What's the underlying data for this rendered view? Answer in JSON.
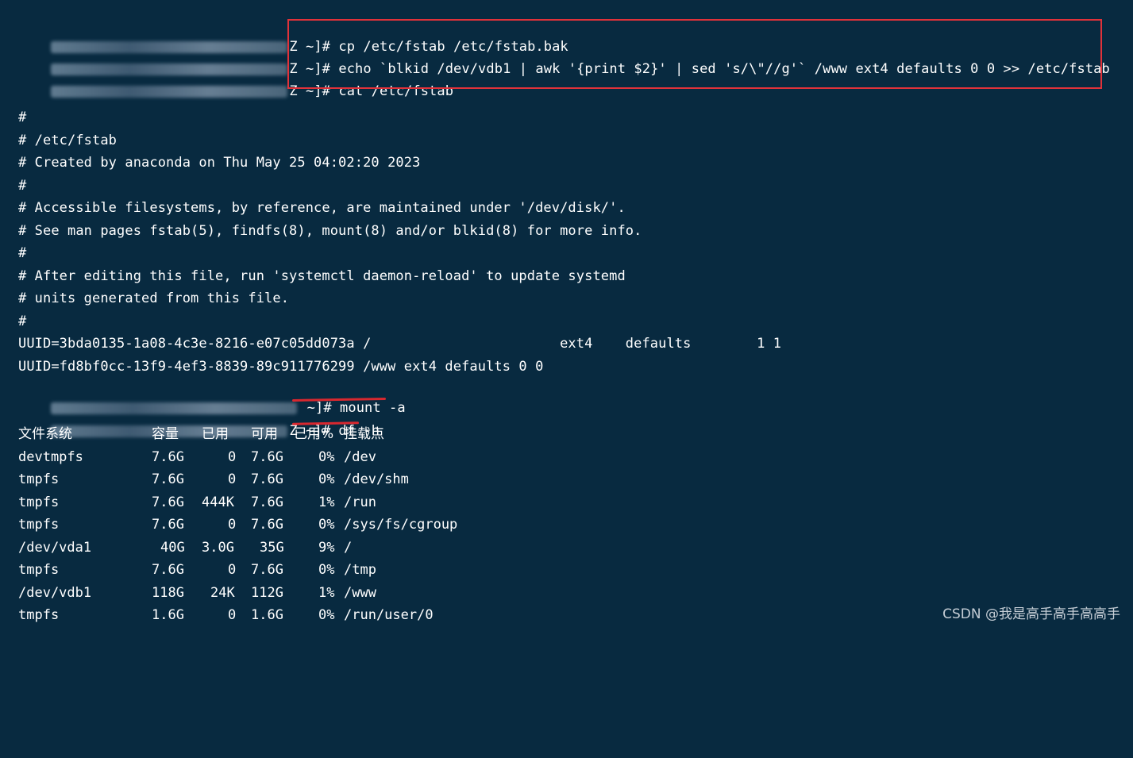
{
  "terminal": {
    "commands": [
      {
        "prompt_suffix": "Z ~]#",
        "command": " cp /etc/fstab /etc/fstab.bak"
      },
      {
        "prompt_suffix": "Z ~]#",
        "command": " echo `blkid /dev/vdb1 | awk '{print $2}' | sed 's/\\\"//g'` /www ext4 defaults 0 0 >> /etc/fstab"
      },
      {
        "prompt_suffix": "Z ~]#",
        "command": " cat /etc/fstab"
      }
    ],
    "fstab_lines": [
      "#",
      "# /etc/fstab",
      "# Created by anaconda on Thu May 25 04:02:20 2023",
      "#",
      "# Accessible filesystems, by reference, are maintained under '/dev/disk/'.",
      "# See man pages fstab(5), findfs(8), mount(8) and/or blkid(8) for more info.",
      "#",
      "# After editing this file, run 'systemctl daemon-reload' to update systemd",
      "# units generated from this file.",
      "#",
      "UUID=3bda0135-1a08-4c3e-8216-e07c05dd073a /                       ext4    defaults        1 1",
      "UUID=fd8bf0cc-13f9-4ef3-8839-89c911776299 /www ext4 defaults 0 0"
    ],
    "mount_cmd": {
      "prompt_suffix": " ~]#",
      "command": " mount -a"
    },
    "df_cmd": {
      "prompt_suffix": "Z ~]#",
      "command": " df -h"
    },
    "df_header": {
      "filesystem": "文件系统",
      "size": "容量",
      "used": "已用",
      "avail": "可用",
      "use_pct": "已用%",
      "mounted_on": "挂载点"
    },
    "df_rows": [
      {
        "fs": "devtmpfs",
        "size": "7.6G",
        "used": "0",
        "avail": "7.6G",
        "pct": "0%",
        "mount": "/dev"
      },
      {
        "fs": "tmpfs",
        "size": "7.6G",
        "used": "0",
        "avail": "7.6G",
        "pct": "0%",
        "mount": "/dev/shm"
      },
      {
        "fs": "tmpfs",
        "size": "7.6G",
        "used": "444K",
        "avail": "7.6G",
        "pct": "1%",
        "mount": "/run"
      },
      {
        "fs": "tmpfs",
        "size": "7.6G",
        "used": "0",
        "avail": "7.6G",
        "pct": "0%",
        "mount": "/sys/fs/cgroup"
      },
      {
        "fs": "/dev/vda1",
        "size": "40G",
        "used": "3.0G",
        "avail": "35G",
        "pct": "9%",
        "mount": "/"
      },
      {
        "fs": "tmpfs",
        "size": "7.6G",
        "used": "0",
        "avail": "7.6G",
        "pct": "0%",
        "mount": "/tmp"
      },
      {
        "fs": "/dev/vdb1",
        "size": "118G",
        "used": "24K",
        "avail": "112G",
        "pct": "1%",
        "mount": "/www"
      },
      {
        "fs": "tmpfs",
        "size": "1.6G",
        "used": "0",
        "avail": "1.6G",
        "pct": "0%",
        "mount": "/run/user/0"
      }
    ]
  },
  "watermark": "CSDN @我是高手高手高高手",
  "colors": {
    "background": "#082a40",
    "text": "#ffffff",
    "annotation_red": "#e0323a"
  }
}
